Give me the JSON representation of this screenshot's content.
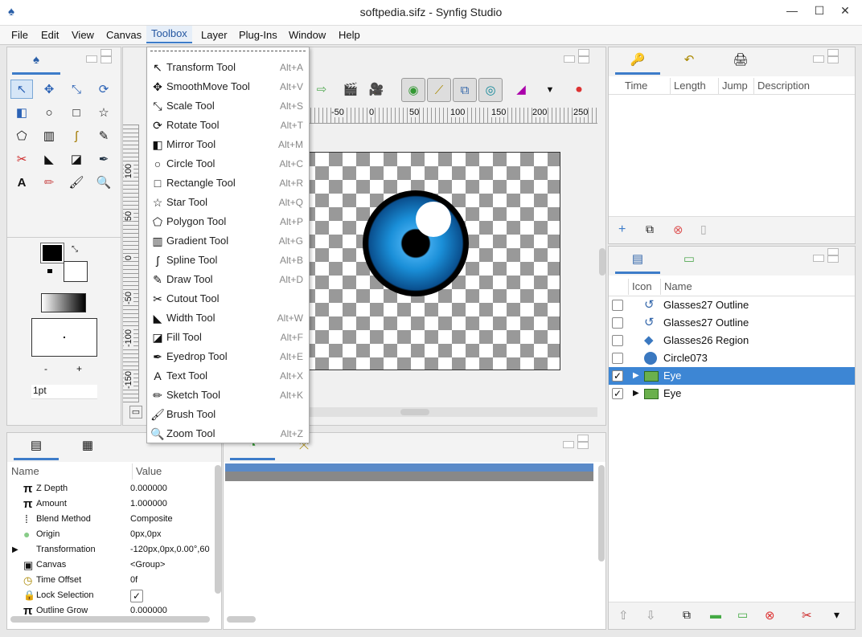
{
  "window": {
    "title": "softpedia.sifz - Synfig Studio",
    "minimize": "—",
    "maximize": "☐",
    "close": "✕"
  },
  "menubar": [
    "File",
    "Edit",
    "View",
    "Canvas",
    "Toolbox",
    "Layer",
    "Plug-Ins",
    "Window",
    "Help"
  ],
  "toolbox_menu": [
    {
      "label": "Transform Tool",
      "accel": "Alt+A",
      "icon": "↖"
    },
    {
      "label": "SmoothMove Tool",
      "accel": "Alt+V",
      "icon": "✥"
    },
    {
      "label": "Scale Tool",
      "accel": "Alt+S",
      "icon": "⤡"
    },
    {
      "label": "Rotate Tool",
      "accel": "Alt+T",
      "icon": "⟳"
    },
    {
      "label": "Mirror Tool",
      "accel": "Alt+M",
      "icon": "◧"
    },
    {
      "label": "Circle Tool",
      "accel": "Alt+C",
      "icon": "○"
    },
    {
      "label": "Rectangle Tool",
      "accel": "Alt+R",
      "icon": "□"
    },
    {
      "label": "Star Tool",
      "accel": "Alt+Q",
      "icon": "☆"
    },
    {
      "label": "Polygon Tool",
      "accel": "Alt+P",
      "icon": "⬠"
    },
    {
      "label": "Gradient Tool",
      "accel": "Alt+G",
      "icon": "▥"
    },
    {
      "label": "Spline Tool",
      "accel": "Alt+B",
      "icon": "ʃ"
    },
    {
      "label": "Draw Tool",
      "accel": "Alt+D",
      "icon": "✎"
    },
    {
      "label": "Cutout Tool",
      "accel": "",
      "icon": "✂"
    },
    {
      "label": "Width Tool",
      "accel": "Alt+W",
      "icon": "◣"
    },
    {
      "label": "Fill Tool",
      "accel": "Alt+F",
      "icon": "◪"
    },
    {
      "label": "Eyedrop Tool",
      "accel": "Alt+E",
      "icon": "✒"
    },
    {
      "label": "Text Tool",
      "accel": "Alt+X",
      "icon": "A"
    },
    {
      "label": "Sketch Tool",
      "accel": "Alt+K",
      "icon": "✏"
    },
    {
      "label": "Brush Tool",
      "accel": "",
      "icon": "🖌"
    },
    {
      "label": "Zoom Tool",
      "accel": "Alt+Z",
      "icon": "🔍"
    }
  ],
  "toolbox_panel": {
    "tools": [
      "↖",
      "✥",
      "⤡",
      "⟳",
      "◧",
      "○",
      "□",
      "☆",
      "⬠",
      "▥",
      "ʃ",
      "✎",
      "✂",
      "◣",
      "◪",
      "✒",
      "A",
      "✏",
      "🖌",
      "🔍"
    ],
    "plus": "+",
    "minus": "-",
    "width_value": "1pt"
  },
  "ruler": {
    "h_labels": [
      "-50",
      "0",
      "50",
      "100",
      "150",
      "200",
      "250"
    ],
    "v_labels": [
      "100",
      "50",
      "0",
      "-50",
      "-100",
      "-150"
    ]
  },
  "keyframes": {
    "headers": [
      "Time",
      "Length",
      "Jump",
      "Description"
    ]
  },
  "layers": {
    "headers": [
      "Icon",
      "Name"
    ],
    "rows": [
      {
        "name": "Glasses27 Outline",
        "checked": false,
        "expander": "",
        "icon": "outline"
      },
      {
        "name": "Glasses27 Outline",
        "checked": false,
        "expander": "",
        "icon": "outline"
      },
      {
        "name": "Glasses26 Region",
        "checked": false,
        "expander": "",
        "icon": "region"
      },
      {
        "name": "Circle073",
        "checked": false,
        "expander": "",
        "icon": "circle"
      },
      {
        "name": "Eye",
        "checked": true,
        "expander": "▶",
        "icon": "folder",
        "selected": true
      },
      {
        "name": "Eye",
        "checked": true,
        "expander": "▶",
        "icon": "folder"
      }
    ],
    "bottom_buttons": [
      "⇧",
      "⇩",
      "⧉",
      "▬",
      "▭",
      "⊗",
      "✂",
      "▾"
    ]
  },
  "params": {
    "headers": [
      "Name",
      "Value"
    ],
    "rows": [
      {
        "icon": "π",
        "name": "Z Depth",
        "value": "0.000000"
      },
      {
        "icon": "π",
        "name": "Amount",
        "value": "1.000000"
      },
      {
        "icon": "⁞",
        "name": "Blend Method",
        "value": "Composite"
      },
      {
        "icon": "●",
        "name": "Origin",
        "value": "0px,0px"
      },
      {
        "icon": "▶",
        "name": "Transformation",
        "value": "-120px,0px,0.00°,60"
      },
      {
        "icon": "▣",
        "name": "Canvas",
        "value": "<Group>"
      },
      {
        "icon": "◷",
        "name": "Time Offset",
        "value": "0f"
      },
      {
        "icon": "🔒",
        "name": "Lock Selection",
        "value": "✓"
      },
      {
        "icon": "π",
        "name": "Outline Grow",
        "value": "0.000000"
      }
    ]
  },
  "colors": {
    "accent": "#3d7cc9",
    "selected_row": "#3d86d4",
    "iris": "#1a8fd8"
  }
}
